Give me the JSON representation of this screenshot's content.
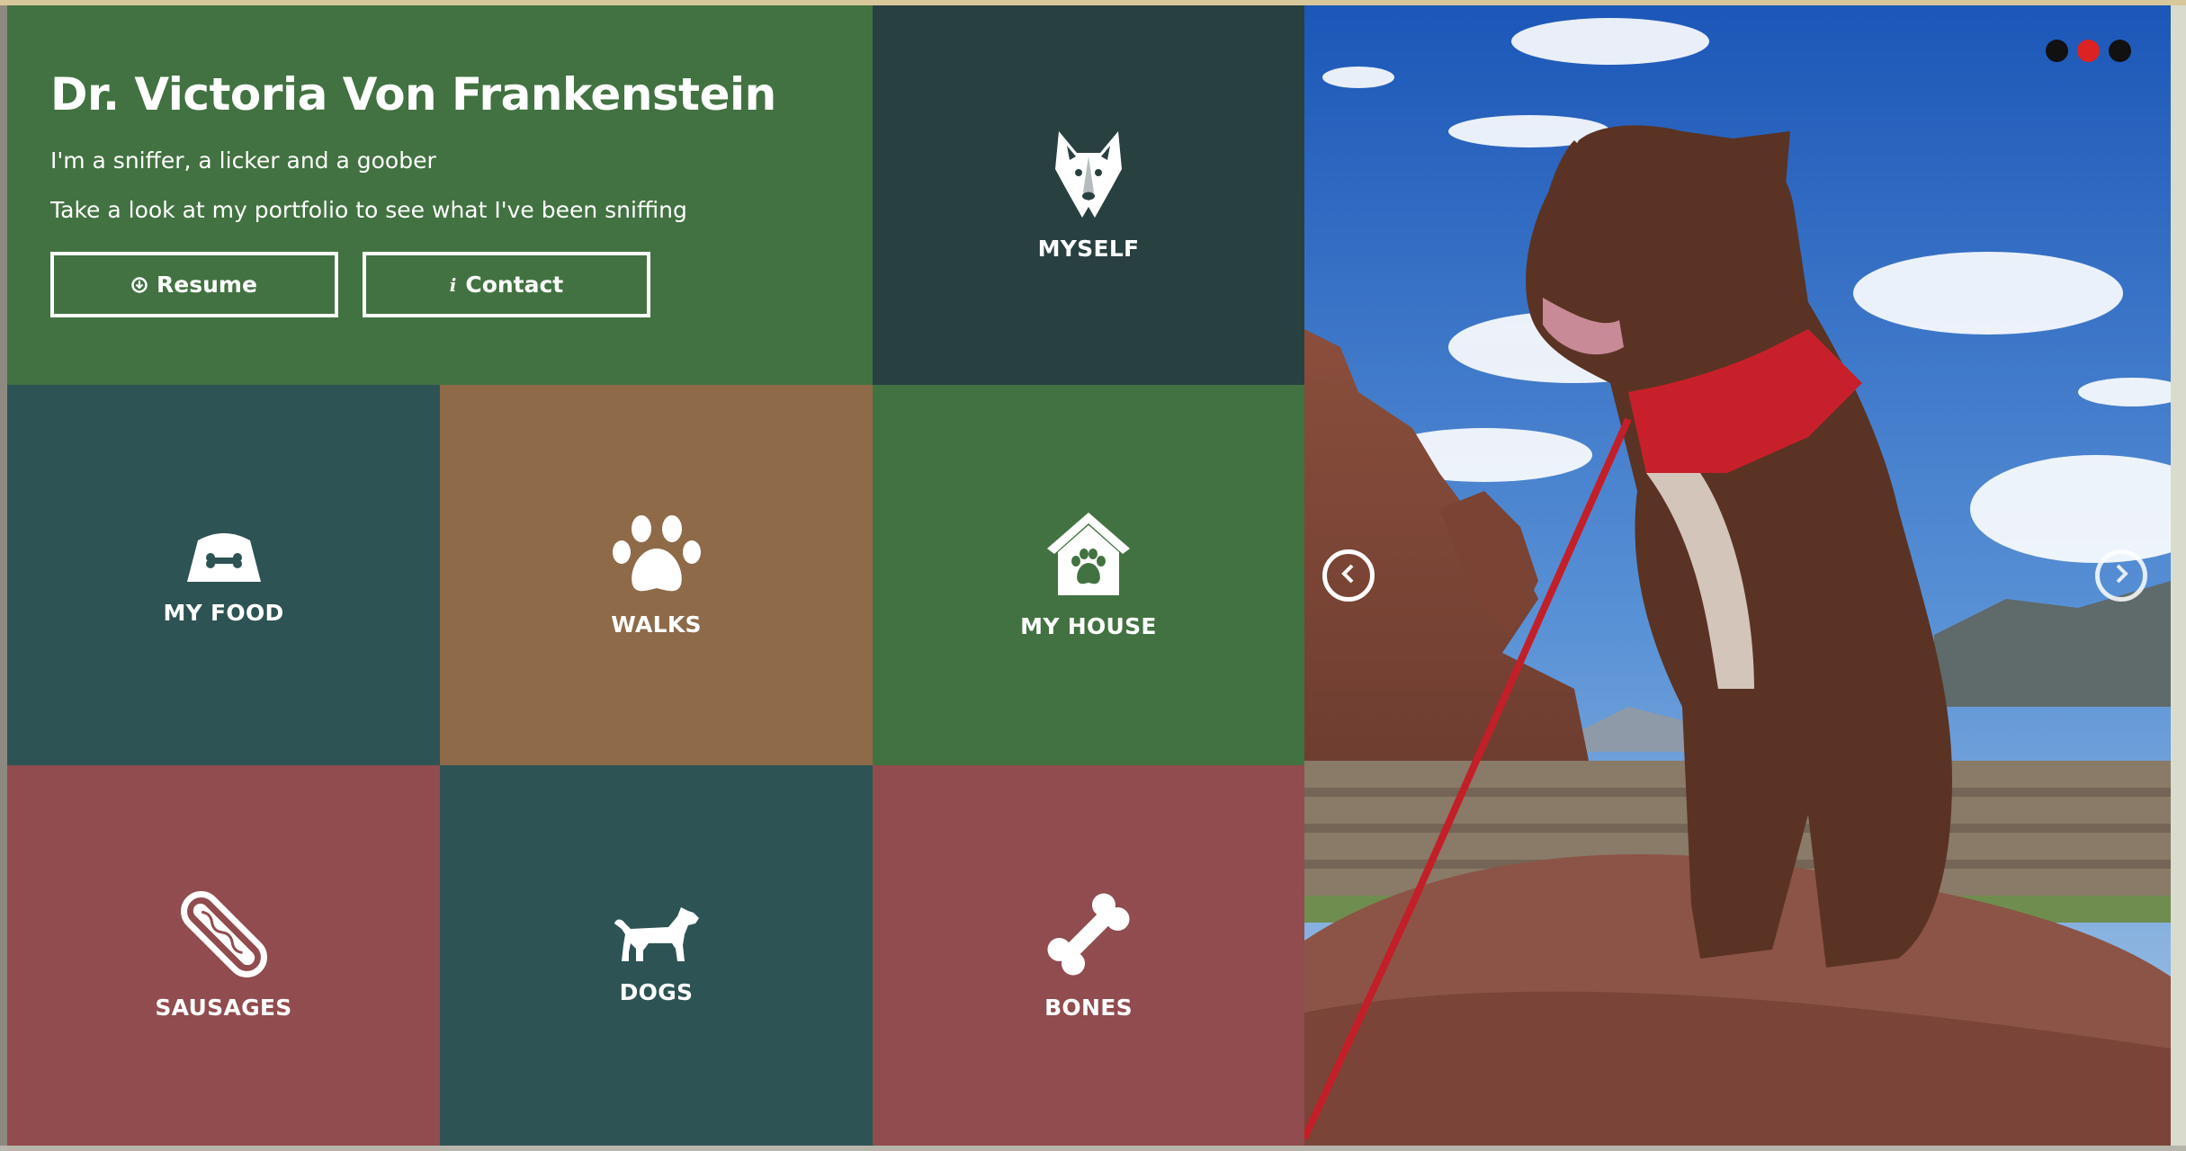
{
  "intro": {
    "name": "Dr. Victoria Von Frankenstein",
    "tagline": "I'm a sniffer, a licker and a goober",
    "subline": "Take a look at my portfolio to see what I've been sniffing",
    "resume_label": "Resume",
    "contact_label": "Contact"
  },
  "tiles": {
    "myself": "MYSELF",
    "my_food": "MY FOOD",
    "walks": "WALKS",
    "my_house": "MY HOUSE",
    "sausages": "SAUSAGES",
    "dogs": "DOGS",
    "bones": "BONES"
  },
  "carousel": {
    "slides": 3,
    "active_slide": 2,
    "prev_icon": "chevron-left-icon",
    "next_icon": "chevron-right-icon"
  },
  "colors": {
    "green": "#427241",
    "dark_teal": "#294041",
    "teal": "#2e5354",
    "brown": "#8e6a49",
    "red": "#904c4e",
    "dot_active": "#dd2222"
  }
}
